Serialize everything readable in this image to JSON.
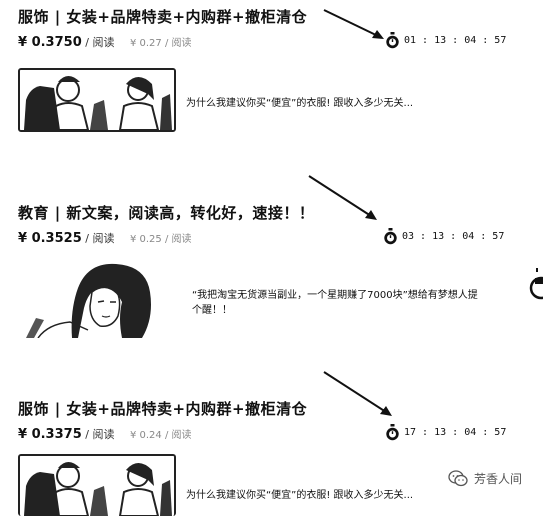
{
  "cards": [
    {
      "title": "服饰 | 女装+品牌特卖+内购群+撤柜清仓",
      "price": "¥ 0.3750",
      "price_unit": "/ 阅读",
      "old_price": "¥ 0.27 / 阅读",
      "countdown": "01 : 13 : 04 : 57",
      "article_text": "为什么我建议你买“便宜”的衣服! 跟收入多少无关..."
    },
    {
      "title": "教育 | 新文案，阅读高，转化好，速接！！",
      "price": "¥ 0.3525",
      "price_unit": "/ 阅读",
      "old_price": "¥ 0.25 / 阅读",
      "countdown": "03 : 13 : 04 : 57",
      "article_text": "“我把淘宝无货源当副业，一个星期赚了7000块”想给有梦想人提个醒！！"
    },
    {
      "title": "服饰 | 女装+品牌特卖+内购群+撤柜清仓",
      "price": "¥ 0.3375",
      "price_unit": "/ 阅读",
      "old_price": "¥ 0.24 / 阅读",
      "countdown": "17 : 13 : 04 : 57",
      "article_text": "为什么我建议你买“便宜”的衣服! 跟收入多少无关..."
    }
  ],
  "watermark": {
    "text": "芳香人间"
  }
}
